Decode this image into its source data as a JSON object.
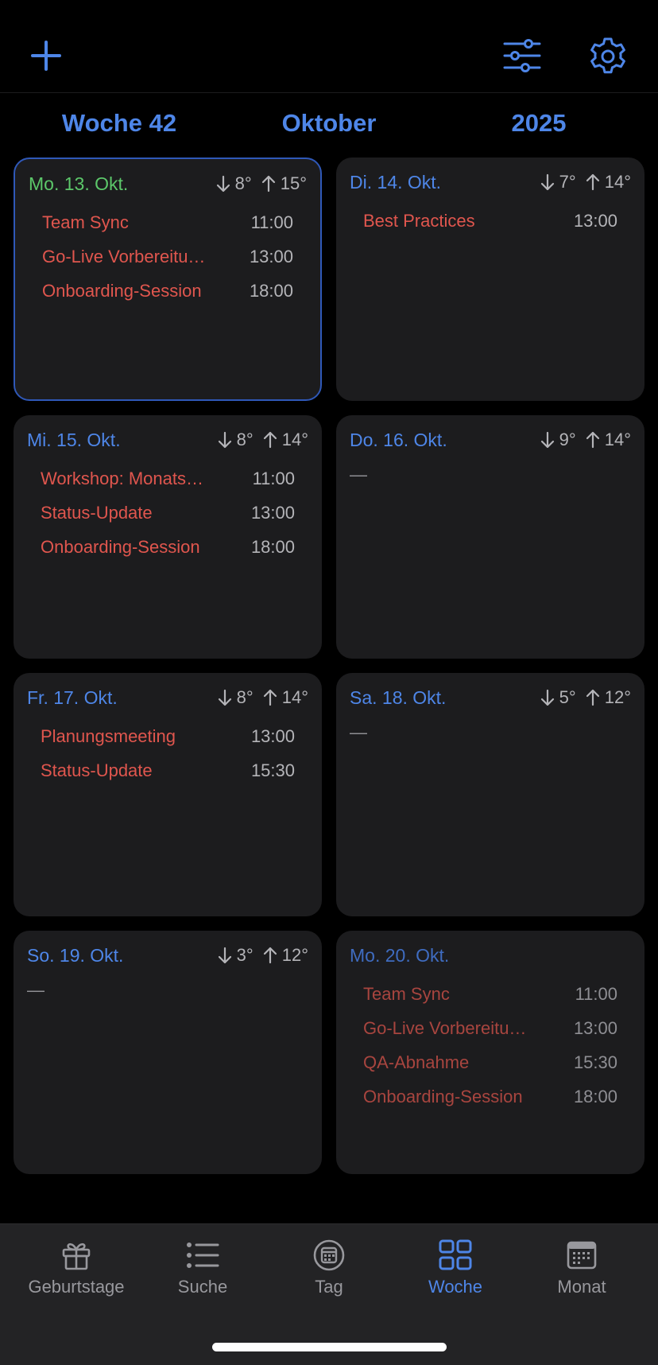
{
  "toolbar": {
    "add_icon": "plus-icon",
    "filter_icon": "sliders-icon",
    "settings_icon": "gear-icon",
    "accent": "#4e86e8"
  },
  "header": {
    "week": "Woche 42",
    "month": "Oktober",
    "year": "2025"
  },
  "days": [
    {
      "date": "Mo. 13. Okt.",
      "low": "8°",
      "high": "15°",
      "events": [
        {
          "title": "Team Sync",
          "time": "11:00"
        },
        {
          "title": "Go-Live Vorbereitu…",
          "time": "13:00"
        },
        {
          "title": "Onboarding-Session",
          "time": "18:00"
        }
      ]
    },
    {
      "date": "Di. 14. Okt.",
      "low": "7°",
      "high": "14°",
      "events": [
        {
          "title": "Best Practices",
          "time": "13:00"
        }
      ]
    },
    {
      "date": "Mi. 15. Okt.",
      "low": "8°",
      "high": "14°",
      "events": [
        {
          "title": "Workshop: Monats…",
          "time": "11:00"
        },
        {
          "title": "Status-Update",
          "time": "13:00"
        },
        {
          "title": "Onboarding-Session",
          "time": "18:00"
        }
      ]
    },
    {
      "date": "Do. 16. Okt.",
      "low": "9°",
      "high": "14°",
      "empty": "—"
    },
    {
      "date": "Fr. 17. Okt.",
      "low": "8°",
      "high": "14°",
      "events": [
        {
          "title": "Planungsmeeting",
          "time": "13:00"
        },
        {
          "title": "Status-Update",
          "time": "15:30"
        }
      ]
    },
    {
      "date": "Sa. 18. Okt.",
      "low": "5°",
      "high": "12°",
      "empty": "—"
    },
    {
      "date": "So. 19. Okt.",
      "low": "3°",
      "high": "12°",
      "empty": "—"
    },
    {
      "date": "Mo. 20. Okt.",
      "events": [
        {
          "title": "Team Sync",
          "time": "11:00"
        },
        {
          "title": "Go-Live Vorbereitu…",
          "time": "13:00"
        },
        {
          "title": "QA-Abnahme",
          "time": "15:30"
        },
        {
          "title": "Onboarding-Session",
          "time": "18:00"
        }
      ]
    }
  ],
  "tabs": [
    {
      "label": "Geburtstage",
      "icon": "gift-icon"
    },
    {
      "label": "Suche",
      "icon": "list-icon"
    },
    {
      "label": "Tag",
      "icon": "calendar-day-icon"
    },
    {
      "label": "Woche",
      "icon": "grid-icon",
      "active": true
    },
    {
      "label": "Monat",
      "icon": "calendar-month-icon"
    }
  ]
}
